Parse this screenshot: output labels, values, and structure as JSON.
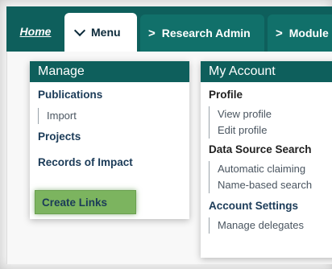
{
  "tabs": [
    {
      "label": "Home"
    },
    {
      "label": "Menu"
    },
    {
      "label": "Research Admin"
    },
    {
      "label": "Module"
    }
  ],
  "manage": {
    "title": "Manage",
    "publications": "Publications",
    "import": "Import",
    "projects": "Projects",
    "records_of_impact": "Records of Impact",
    "create_links": "Create Links"
  },
  "account": {
    "title": "My Account",
    "profile": "Profile",
    "view_profile": "View profile",
    "edit_profile": "Edit profile",
    "data_source_search": "Data Source Search",
    "automatic_claiming": "Automatic claiming",
    "name_based_search": "Name-based search",
    "account_settings": "Account Settings",
    "manage_delegates": "Manage delegates"
  },
  "colors": {
    "nav_bg": "#0e5f5c",
    "tab_bg": "#11706a",
    "highlight": "#7cb45f"
  }
}
